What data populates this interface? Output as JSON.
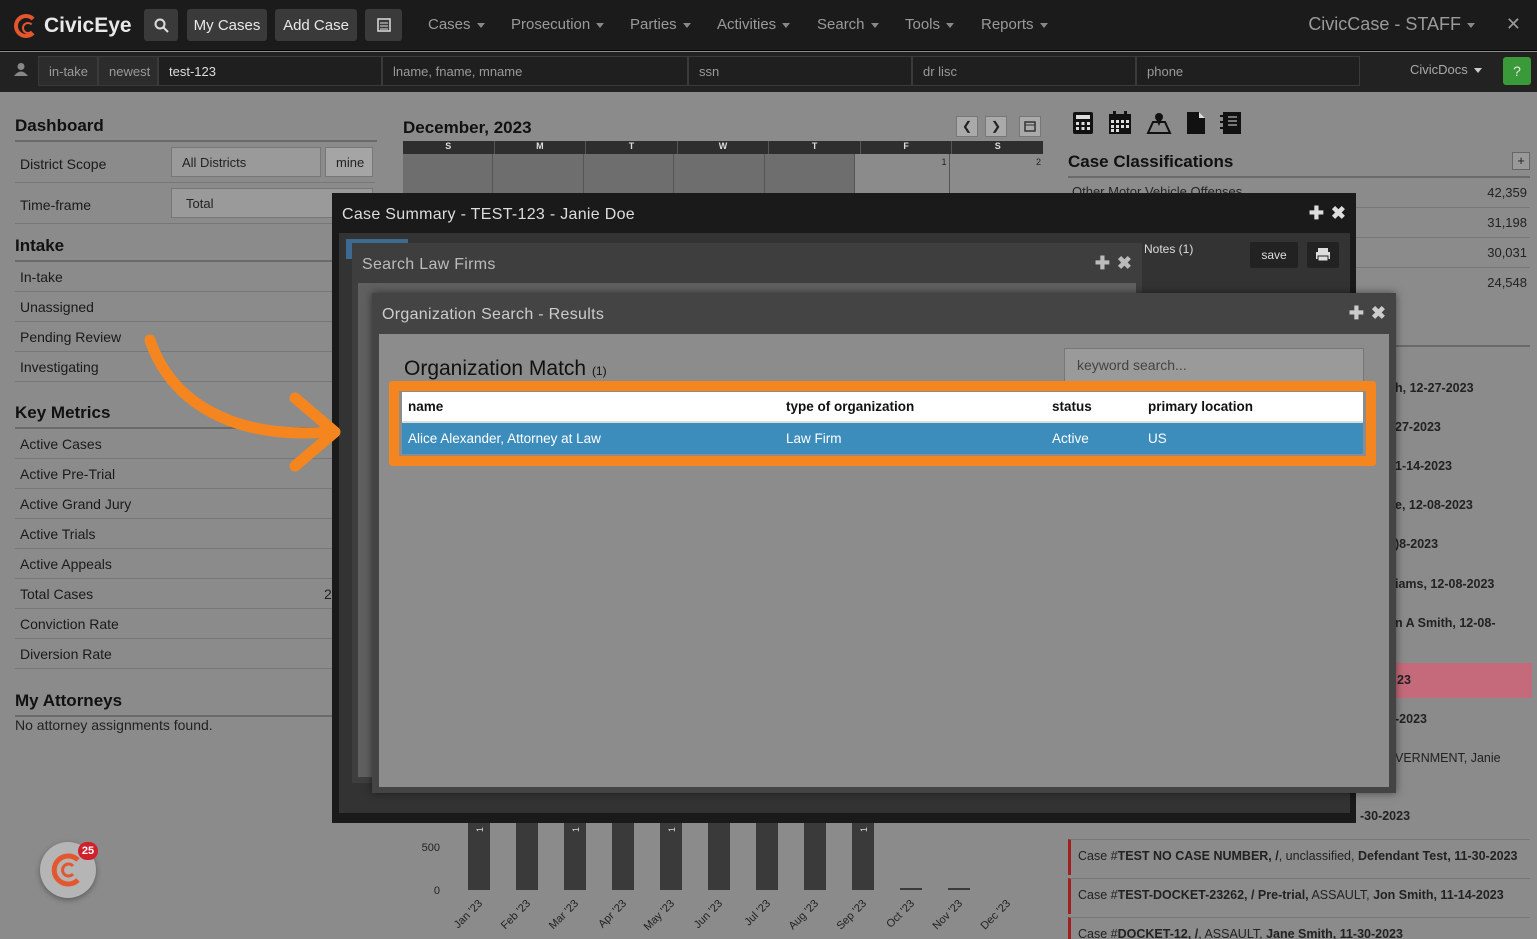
{
  "nav": {
    "brand": "CivicEye",
    "my_cases": "My Cases",
    "add_case": "Add Case",
    "menus": [
      "Cases",
      "Prosecution",
      "Parties",
      "Activities",
      "Search",
      "Tools",
      "Reports"
    ],
    "app_name": "CivicCase - STAFF"
  },
  "searchbar": {
    "intake": "in-take",
    "newest": "newest",
    "case_value": "test-123",
    "name_placeholder": "lname, fname, mname",
    "ssn_placeholder": "ssn",
    "drlisc_placeholder": "dr lisc",
    "phone_placeholder": "phone",
    "civicdocs": "CivicDocs",
    "help": "?"
  },
  "dashboard": {
    "title": "Dashboard",
    "district_scope_label": "District Scope",
    "district_scope_value": "All Districts",
    "mine": "mine",
    "timeframe_label": "Time-frame",
    "timeframe_value": "Total",
    "intake_title": "Intake",
    "intake_items": [
      "In-take",
      "Unassigned",
      "Pending Review",
      "Investigating"
    ],
    "metrics_title": "Key Metrics",
    "metrics_items": [
      "Active Cases",
      "Active Pre-Trial",
      "Active Grand Jury",
      "Active Trials",
      "Active Appeals",
      "Total Cases",
      "Conviction Rate",
      "Diversion Rate"
    ],
    "total_cases_partial": "2",
    "attorneys_title": "My Attorneys",
    "attorneys_empty": "No attorney assignments found."
  },
  "calendar": {
    "title": "December, 2023",
    "days": [
      "S",
      "M",
      "T",
      "W",
      "T",
      "F",
      "S"
    ],
    "dates": [
      "1",
      "2"
    ]
  },
  "classifications": {
    "title": "Case Classifications",
    "first_label": "Other Motor Vehicle Offenses",
    "counts": [
      "42,359",
      "31,198",
      "30,031",
      "24,548"
    ]
  },
  "activity": {
    "partial": [
      "h, 12-27-2023",
      "27-2023",
      "1-14-2023",
      "e, 12-08-2023",
      ")8-2023",
      "iams, 12-08-2023",
      "n A Smith, 12-08-",
      "23",
      "-2023",
      "VERNMENT, Janie",
      "-30-2023"
    ],
    "full": [
      {
        "case": "TEST NO CASE NUMBER, /",
        "rest": ", unclassified,",
        "party": "Defendant Test, 11-30-2023"
      },
      {
        "case": "TEST-DOCKET-23262, / Pre-trial,",
        "rest": " ASSAULT,",
        "party": "Jon Smith, 11-14-2023"
      },
      {
        "case": "DOCKET-12, /",
        "rest": ", ASSAULT,",
        "party": "Jane Smith, 11-30-2023"
      }
    ],
    "case_prefix": "Case #"
  },
  "chart_data": {
    "type": "bar",
    "categories": [
      "Jan '23",
      "Feb '23",
      "Mar '23",
      "Apr '23",
      "May '23",
      "Jun '23",
      "Jul '23",
      "Aug '23",
      "Sep '23",
      "Oct '23",
      "Nov '23",
      "Dec '23"
    ],
    "values": [
      1080,
      1080,
      1050,
      1080,
      1070,
      1080,
      1080,
      1050,
      1080,
      10,
      20,
      0
    ],
    "yticks": [
      "500",
      "0"
    ],
    "bar_labels": [
      "1",
      "1",
      "1",
      "1"
    ],
    "ylim": [
      0,
      1100
    ]
  },
  "case_summary": {
    "title": "Case Summary - TEST-123 - Janie Doe",
    "notes_tab": "Notes (1)",
    "save": "save"
  },
  "law_firms": {
    "title": "Search Law Firms"
  },
  "org_results": {
    "title": "Organization Search - Results",
    "heading": "Organization Match",
    "count": "(1)",
    "keyword_placeholder": "keyword search...",
    "columns": [
      "name",
      "type of organization",
      "status",
      "primary location"
    ],
    "rows": [
      [
        "Alice Alexander, Attorney at Law",
        "Law Firm",
        "Active",
        "US"
      ]
    ]
  },
  "chat": {
    "badge": "25"
  },
  "colors": {
    "accent": "#f5861f",
    "selected_row": "#3c8dbc",
    "brand": "#e4572e"
  }
}
